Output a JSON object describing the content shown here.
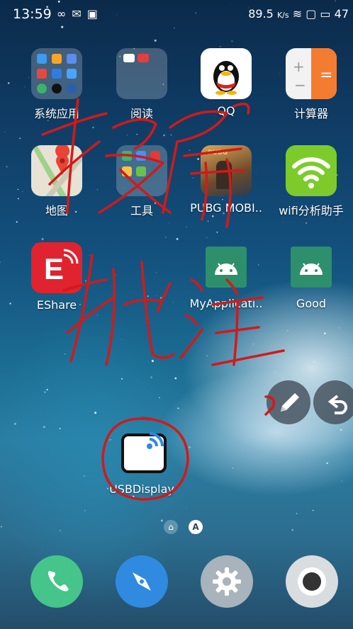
{
  "status": {
    "time": "13:59",
    "speed": "89.5",
    "speed_unit": "K/s",
    "battery": "47"
  },
  "apps": [
    {
      "label": "系统应用"
    },
    {
      "label": "阅读"
    },
    {
      "label": "QQ"
    },
    {
      "label": "计算器"
    },
    {
      "label": "地图"
    },
    {
      "label": "工具"
    },
    {
      "label": "PUBG MOBI.."
    },
    {
      "label": "wifi分析助手"
    },
    {
      "label": "EShare"
    },
    {
      "label": "MyApplicati.."
    },
    {
      "label": "Good"
    },
    {
      "label": "USBDisplay"
    }
  ],
  "page_indicator": {
    "letter": "A"
  },
  "icons": {
    "colors": {
      "eshare": "#e0232e",
      "android_green": "#2d8f6b",
      "wifi_green": "#7ccb2b",
      "calc_orange": "#f47c30"
    }
  }
}
